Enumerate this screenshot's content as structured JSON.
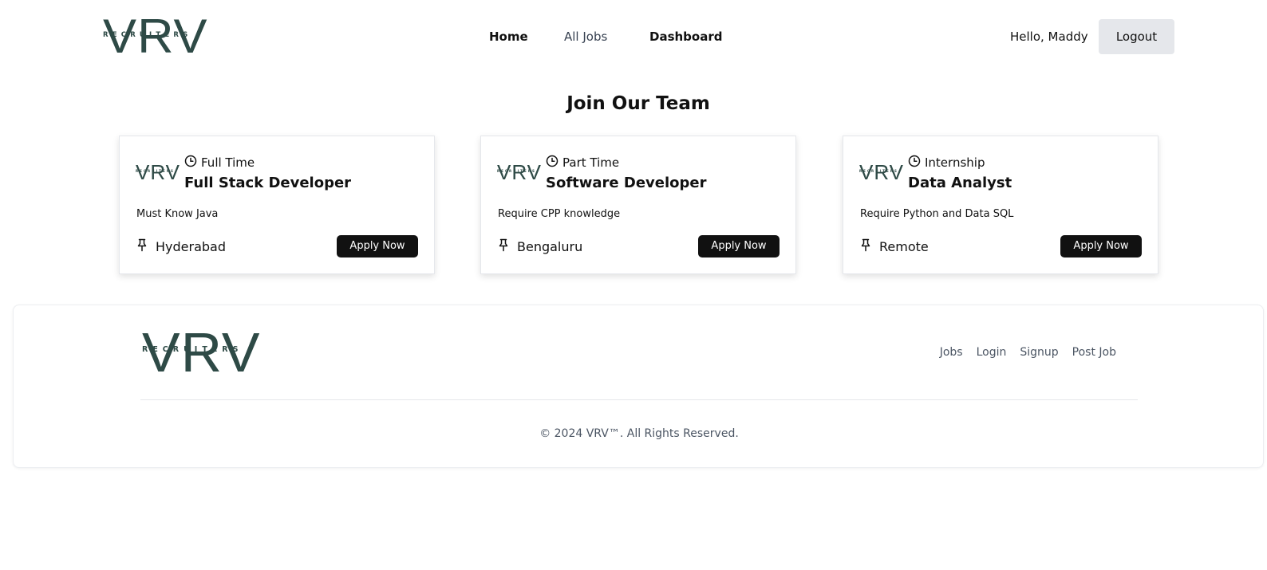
{
  "header": {
    "logo": {
      "letters": "VRV",
      "tagline": "RECRUITERS"
    },
    "nav": [
      {
        "label": "Home"
      },
      {
        "label": "All Jobs"
      },
      {
        "label": "Dashboard"
      }
    ],
    "greeting": "Hello, Maddy",
    "logout_label": "Logout"
  },
  "main": {
    "title": "Join Our Team",
    "jobs": [
      {
        "type": "Full Time",
        "title": "Full Stack Developer",
        "description": "Must Know Java",
        "location": "Hyderabad",
        "apply_label": "Apply Now"
      },
      {
        "type": "Part Time",
        "title": "Software Developer",
        "description": "Require CPP knowledge",
        "location": "Bengaluru",
        "apply_label": "Apply Now"
      },
      {
        "type": "Internship",
        "title": "Data Analyst",
        "description": "Require Python and Data SQL",
        "location": "Remote",
        "apply_label": "Apply Now"
      }
    ]
  },
  "footer": {
    "logo": {
      "letters": "VRV",
      "tagline": "RECRUITERS"
    },
    "links": [
      {
        "label": "Jobs"
      },
      {
        "label": "Login"
      },
      {
        "label": "Signup"
      },
      {
        "label": "Post Job"
      }
    ],
    "copyright": "© 2024 VRV™. All Rights Reserved."
  },
  "colors": {
    "brand": "#2e4a46",
    "button_dark": "#111111",
    "logout_bg": "#e5e7eb",
    "muted_text": "#4b5563"
  },
  "icons": [
    "clock-icon",
    "pin-icon"
  ]
}
